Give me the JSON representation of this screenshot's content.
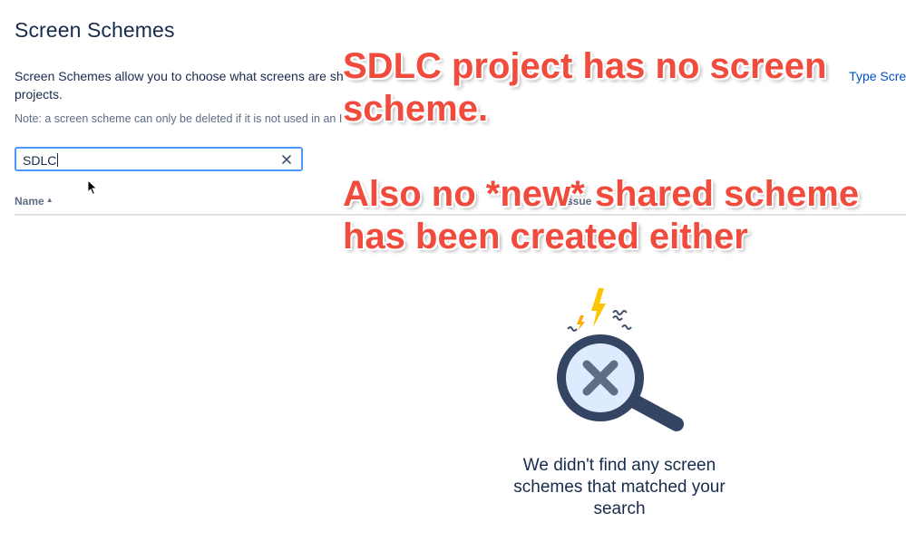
{
  "page": {
    "title": "Screen Schemes",
    "description_start": "Screen Schemes allow you to choose what screens are sh",
    "description_link": "Type Scree",
    "description_end": "projects.",
    "note": "Note: a screen scheme can only be deleted if it is not used in an I"
  },
  "search": {
    "value": "SDLC",
    "clear_icon": "close-icon"
  },
  "table": {
    "columns": [
      "Name",
      "ssue"
    ],
    "sorted_column": "Name",
    "sort_direction": "ascending"
  },
  "empty_state": {
    "icon": "magnifier-x-icon",
    "message": "We didn't find any screen schemes that matched your search"
  },
  "annotations": [
    "SDLC project has no screen scheme.",
    "Also no *new* shared scheme has been created either"
  ],
  "colors": {
    "accent": "#4c9aff",
    "link": "#0052cc",
    "annotation": "#f04b3d",
    "text": "#172b4d"
  }
}
